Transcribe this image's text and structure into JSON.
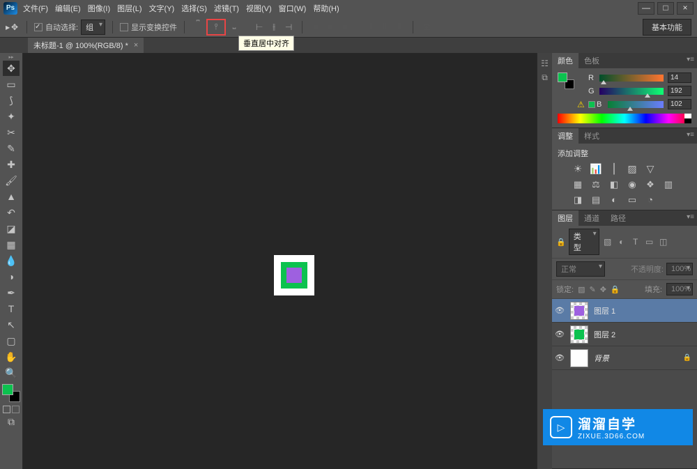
{
  "app": {
    "logo": "Ps"
  },
  "menu": [
    "文件(F)",
    "编辑(E)",
    "图像(I)",
    "图层(L)",
    "文字(Y)",
    "选择(S)",
    "滤镜(T)",
    "视图(V)",
    "窗口(W)",
    "帮助(H)"
  ],
  "options": {
    "autoSelect": "自动选择:",
    "autoSelectMode": "组",
    "showTransform": "显示变换控件",
    "workspace": "基本功能"
  },
  "tooltip": "垂直居中对齐",
  "docTab": "未标题-1 @ 100%(RGB/8) *",
  "colorPanel": {
    "tabs": [
      "颜色",
      "色板"
    ],
    "r": {
      "label": "R",
      "value": "14",
      "pct": 6
    },
    "g": {
      "label": "G",
      "value": "192",
      "pct": 75
    },
    "b": {
      "label": "B",
      "value": "102",
      "pct": 40
    }
  },
  "adjustPanel": {
    "tabs": [
      "调整",
      "样式"
    ],
    "text": "添加调整"
  },
  "layersPanel": {
    "tabs": [
      "图层",
      "通道",
      "路径"
    ],
    "kind": "类型",
    "blend": "正常",
    "opacityLabel": "不透明度:",
    "opacity": "100%",
    "lockLabel": "锁定:",
    "fillLabel": "填充:",
    "fill": "100%",
    "layers": [
      {
        "name": "图层 1",
        "color": "#9e60e0",
        "selected": true,
        "trans": true
      },
      {
        "name": "图层 2",
        "color": "#0cc24f",
        "selected": false,
        "trans": true
      },
      {
        "name": "背景",
        "color": "#ffffff",
        "selected": false,
        "locked": true,
        "italic": true
      }
    ]
  },
  "watermark": {
    "title": "溜溜自学",
    "url": "ZIXUE.3D66.COM"
  }
}
